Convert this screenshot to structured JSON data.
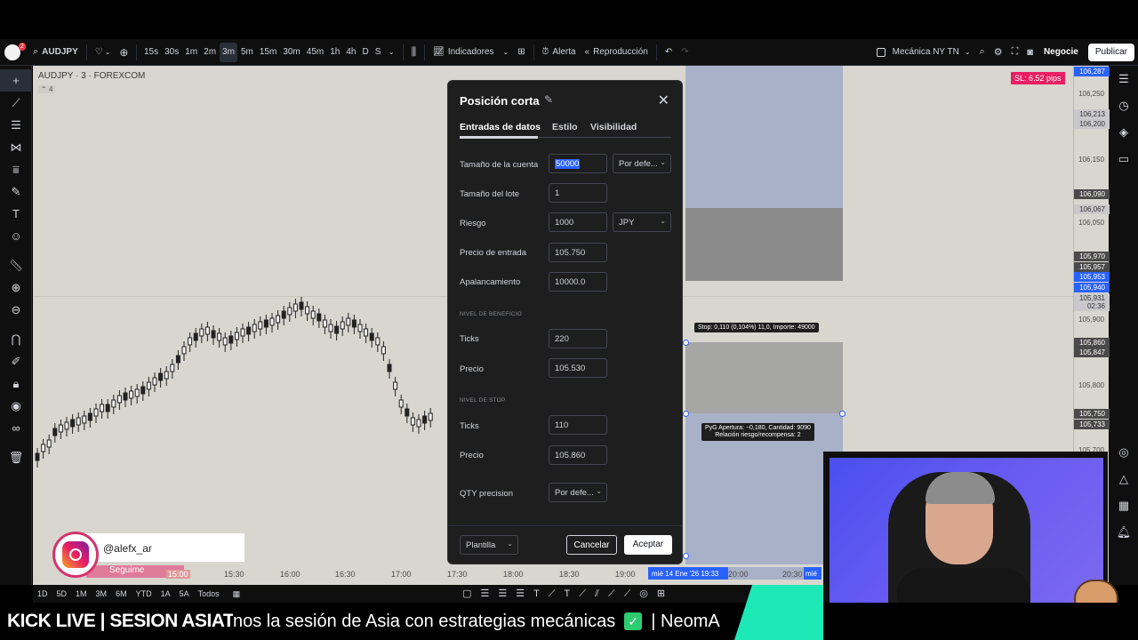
{
  "toolbar": {
    "symbol": "AUDJPY",
    "intervals": [
      "15s",
      "30s",
      "1m",
      "2m",
      "3m",
      "5m",
      "15m",
      "30m",
      "45m",
      "1h",
      "4h",
      "D",
      "S"
    ],
    "active_interval": "3m",
    "indicators_label": "Indicadores",
    "alert_label": "Alerta",
    "replay_label": "Reproducción",
    "layout_name": "Mecánica NY TN",
    "trade_label": "Negocie",
    "publish_label": "Publicar",
    "notification_count": "2"
  },
  "chart": {
    "title": "AUDJPY · 3 · FOREXCOM",
    "sub_count": "4",
    "sl_badge": "SL: 6.52 pips",
    "stop_label": "Stop: 0,110 (0,104%) 11,0, Importe: 49000",
    "pnl_label_line1": "PyG Apertura: −0,180, Cantidad: 9090",
    "pnl_label_line2": "Relación riesgo/recompensa: 2"
  },
  "price_scale": {
    "labels": [
      "106,250",
      "106,150",
      "106,050",
      "105,900",
      "105,800",
      "105,700"
    ],
    "tags": [
      {
        "text": "106,287",
        "color": "#2962ff"
      },
      {
        "text": "106,213",
        "color": "#c9c9cc"
      },
      {
        "text": "106,200",
        "color": "#c9c9cc"
      },
      {
        "text": "106,090",
        "color": "#4a4a4a"
      },
      {
        "text": "106,067",
        "color": "#c9c9cc"
      },
      {
        "text": "105,970",
        "color": "#4a4a4a"
      },
      {
        "text": "105,957",
        "color": "#4a4a4a"
      },
      {
        "text": "105,953",
        "color": "#2962ff"
      },
      {
        "text": "105,940",
        "color": "#2962ff"
      },
      {
        "text": "105,931",
        "color": "#c9c9cc"
      },
      {
        "text": "02:36",
        "color": "#c9c9cc"
      },
      {
        "text": "105,860",
        "color": "#4a4a4a"
      },
      {
        "text": "105,847",
        "color": "#4a4a4a"
      },
      {
        "text": "105,750",
        "color": "#4a4a4a"
      },
      {
        "text": "105,733",
        "color": "#4a4a4a"
      }
    ]
  },
  "time_scale": {
    "labels": [
      "15:00",
      "15:30",
      "16:00",
      "16:30",
      "17:00",
      "17:30",
      "18:00",
      "18:30",
      "19:00",
      "20:00",
      "20:30"
    ],
    "highlight": "mié 14 Ene '26  19:33",
    "right_tag": "mié"
  },
  "range_bar": {
    "items": [
      "1D",
      "5D",
      "1M",
      "3M",
      "6M",
      "YTD",
      "1A",
      "5A",
      "Todos"
    ]
  },
  "dialog": {
    "title": "Posición corta",
    "tabs": [
      "Entradas de datos",
      "Estilo",
      "Visibilidad"
    ],
    "account_size_label": "Tamaño de la cuenta",
    "account_size_value": "50000",
    "account_mode": "Por defe...",
    "lot_size_label": "Tamaño del lote",
    "lot_size_value": "1",
    "risk_label": "Riesgo",
    "risk_value": "1000",
    "risk_currency": "JPY",
    "entry_price_label": "Precio de entrada",
    "entry_price_value": "105.750",
    "leverage_label": "Apalancamiento",
    "leverage_value": "10000.0",
    "profit_section": "NIVEL DE BENEFICIO",
    "profit_ticks_label": "Ticks",
    "profit_ticks_value": "220",
    "profit_price_label": "Precio",
    "profit_price_value": "105.530",
    "stop_section": "NIVEL DE STOP",
    "stop_ticks_label": "Ticks",
    "stop_ticks_value": "110",
    "stop_price_label": "Precio",
    "stop_price_value": "105.860",
    "qty_label": "QTY precision",
    "qty_value": "Por defe...",
    "template_label": "Plantilla",
    "cancel_label": "Cancelar",
    "accept_label": "Aceptar"
  },
  "social": {
    "handle": "@alefx_ar",
    "follow": "Seguime"
  },
  "banner": {
    "left": "KICK LIVE | SESION ASIATICA",
    "ticker_a": "nos la sesión de Asia con estrategias mecánicas",
    "ticker_b": "| NeomA"
  },
  "colors": {
    "profit_zone": "#a9b1c9",
    "stop_zone": "#8a8a8a",
    "chart_bg": "#d8d6cf",
    "accent_blue": "#2962ff",
    "sl_badge": "#e91e63"
  }
}
